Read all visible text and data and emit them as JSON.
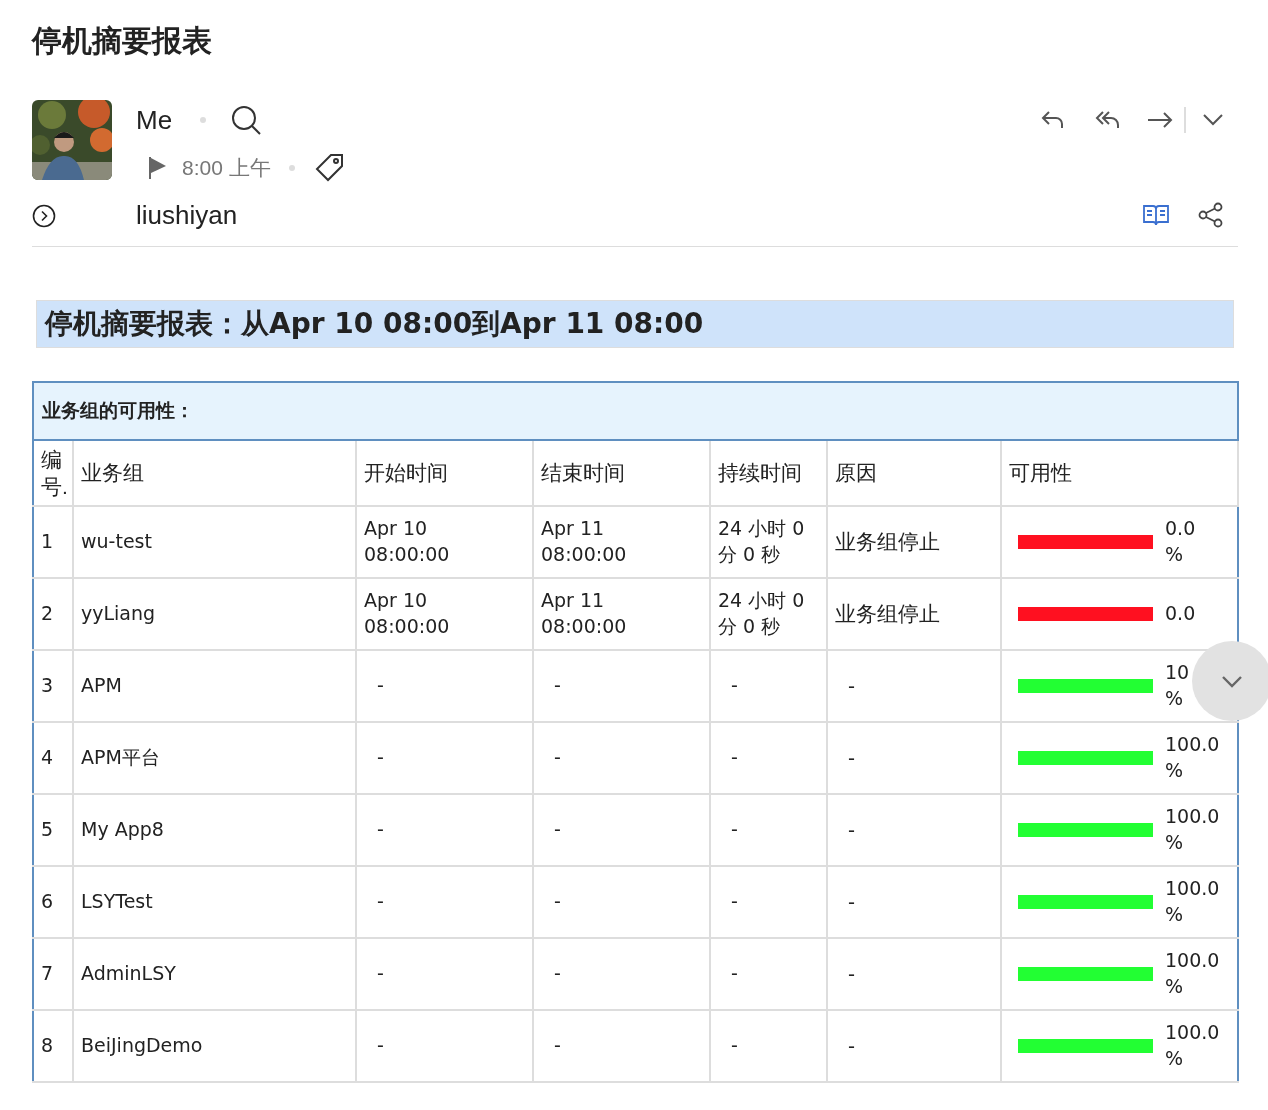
{
  "page_title": "停机摘要报表",
  "message": {
    "sender": "Me",
    "time": "8:00 上午",
    "recipient": "liushiyan"
  },
  "report_banner": "停机摘要报表：从Apr 10 08:00到Apr 11 08:00",
  "section_title": "业务组的可用性：",
  "columns": [
    "编号.",
    "业务组",
    "开始时间",
    "结束时间",
    "持续时间",
    "原因",
    "可用性"
  ],
  "rows": [
    {
      "no": "1",
      "group": "wu-test",
      "start": "Apr 10 08:00:00",
      "end": "Apr 11 08:00:00",
      "duration": "24 小时 0 分 0 秒",
      "reason": "业务组停止",
      "availability": "0.0 %",
      "color": "#ff1020"
    },
    {
      "no": "2",
      "group": "yyLiang",
      "start": "Apr 10 08:00:00",
      "end": "Apr 11 08:00:00",
      "duration": "24 小时 0 分 0 秒",
      "reason": "业务组停止",
      "availability": "0.0",
      "color": "#ff1020"
    },
    {
      "no": "3",
      "group": "APM",
      "start": "-",
      "end": "-",
      "duration": "-",
      "reason": "-",
      "availability": "10 %",
      "color": "#22ff33"
    },
    {
      "no": "4",
      "group": "APM平台",
      "start": "-",
      "end": "-",
      "duration": "-",
      "reason": "-",
      "availability": "100.0 %",
      "color": "#22ff33"
    },
    {
      "no": "5",
      "group": "My App8",
      "start": "-",
      "end": "-",
      "duration": "-",
      "reason": "-",
      "availability": "100.0 %",
      "color": "#22ff33"
    },
    {
      "no": "6",
      "group": "LSYTest",
      "start": "-",
      "end": "-",
      "duration": "-",
      "reason": "-",
      "availability": "100.0 %",
      "color": "#22ff33"
    },
    {
      "no": "7",
      "group": "AdminLSY",
      "start": "-",
      "end": "-",
      "duration": "-",
      "reason": "-",
      "availability": "100.0 %",
      "color": "#22ff33"
    },
    {
      "no": "8",
      "group": "BeiJingDemo",
      "start": "-",
      "end": "-",
      "duration": "-",
      "reason": "-",
      "availability": "100.0 %",
      "color": "#22ff33"
    }
  ]
}
